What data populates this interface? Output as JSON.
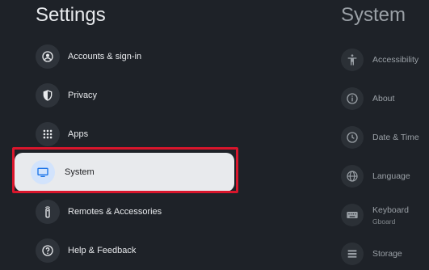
{
  "left_panel": {
    "title": "Settings",
    "items": [
      {
        "label": "Accounts & sign-in",
        "icon": "account-icon"
      },
      {
        "label": "Privacy",
        "icon": "shield-icon"
      },
      {
        "label": "Apps",
        "icon": "apps-grid-icon"
      },
      {
        "label": "System",
        "icon": "tv-icon",
        "selected": true
      },
      {
        "label": "Remotes & Accessories",
        "icon": "remote-icon"
      },
      {
        "label": "Help & Feedback",
        "icon": "help-icon"
      }
    ]
  },
  "right_panel": {
    "title": "System",
    "items": [
      {
        "label": "Accessibility",
        "icon": "accessibility-icon"
      },
      {
        "label": "About",
        "icon": "info-icon"
      },
      {
        "label": "Date & Time",
        "icon": "clock-icon"
      },
      {
        "label": "Language",
        "icon": "globe-icon"
      },
      {
        "label": "Keyboard",
        "sublabel": "Gboard",
        "icon": "keyboard-icon"
      },
      {
        "label": "Storage",
        "icon": "storage-icon"
      }
    ]
  },
  "colors": {
    "background": "#1e2228",
    "selected_bg": "#e8eaed",
    "highlight": "#d9162c",
    "accent": "#1a73e8"
  }
}
